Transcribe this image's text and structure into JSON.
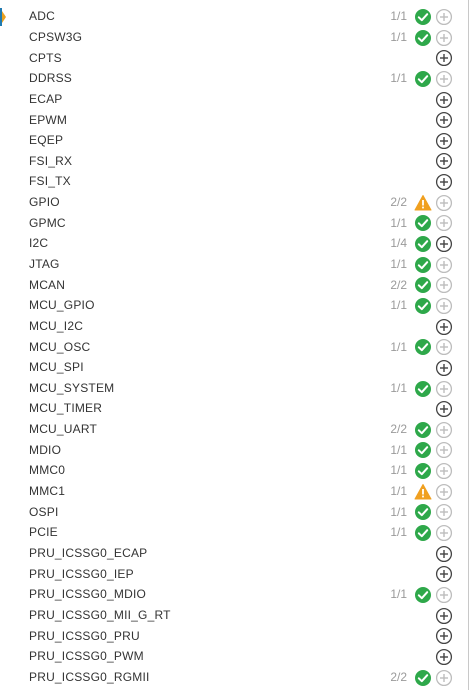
{
  "colors": {
    "ok": "#2ea84a",
    "warn": "#f0a020",
    "add_active": "#444444",
    "add_disabled": "#bdbdbd",
    "text": "#333333",
    "count": "#9a9a9a"
  },
  "modules": [
    {
      "name": "ADC",
      "count": "1/1",
      "status": "ok",
      "add": "disabled"
    },
    {
      "name": "CPSW3G",
      "count": "1/1",
      "status": "ok",
      "add": "disabled"
    },
    {
      "name": "CPTS",
      "count": "",
      "status": "none",
      "add": "active"
    },
    {
      "name": "DDRSS",
      "count": "1/1",
      "status": "ok",
      "add": "disabled"
    },
    {
      "name": "ECAP",
      "count": "",
      "status": "none",
      "add": "active"
    },
    {
      "name": "EPWM",
      "count": "",
      "status": "none",
      "add": "active"
    },
    {
      "name": "EQEP",
      "count": "",
      "status": "none",
      "add": "active"
    },
    {
      "name": "FSI_RX",
      "count": "",
      "status": "none",
      "add": "active"
    },
    {
      "name": "FSI_TX",
      "count": "",
      "status": "none",
      "add": "active"
    },
    {
      "name": "GPIO",
      "count": "2/2",
      "status": "warn",
      "add": "disabled"
    },
    {
      "name": "GPMC",
      "count": "1/1",
      "status": "ok",
      "add": "disabled"
    },
    {
      "name": "I2C",
      "count": "1/4",
      "status": "ok",
      "add": "active"
    },
    {
      "name": "JTAG",
      "count": "1/1",
      "status": "ok",
      "add": "disabled"
    },
    {
      "name": "MCAN",
      "count": "2/2",
      "status": "ok",
      "add": "disabled"
    },
    {
      "name": "MCU_GPIO",
      "count": "1/1",
      "status": "ok",
      "add": "disabled"
    },
    {
      "name": "MCU_I2C",
      "count": "",
      "status": "none",
      "add": "active"
    },
    {
      "name": "MCU_OSC",
      "count": "1/1",
      "status": "ok",
      "add": "disabled"
    },
    {
      "name": "MCU_SPI",
      "count": "",
      "status": "none",
      "add": "active"
    },
    {
      "name": "MCU_SYSTEM",
      "count": "1/1",
      "status": "ok",
      "add": "disabled"
    },
    {
      "name": "MCU_TIMER",
      "count": "",
      "status": "none",
      "add": "active"
    },
    {
      "name": "MCU_UART",
      "count": "2/2",
      "status": "ok",
      "add": "disabled"
    },
    {
      "name": "MDIO",
      "count": "1/1",
      "status": "ok",
      "add": "disabled"
    },
    {
      "name": "MMC0",
      "count": "1/1",
      "status": "ok",
      "add": "disabled"
    },
    {
      "name": "MMC1",
      "count": "1/1",
      "status": "warn",
      "add": "disabled"
    },
    {
      "name": "OSPI",
      "count": "1/1",
      "status": "ok",
      "add": "disabled"
    },
    {
      "name": "PCIE",
      "count": "1/1",
      "status": "ok",
      "add": "disabled"
    },
    {
      "name": "PRU_ICSSG0_ECAP",
      "count": "",
      "status": "none",
      "add": "active"
    },
    {
      "name": "PRU_ICSSG0_IEP",
      "count": "",
      "status": "none",
      "add": "active"
    },
    {
      "name": "PRU_ICSSG0_MDIO",
      "count": "1/1",
      "status": "ok",
      "add": "disabled"
    },
    {
      "name": "PRU_ICSSG0_MII_G_RT",
      "count": "",
      "status": "none",
      "add": "active"
    },
    {
      "name": "PRU_ICSSG0_PRU",
      "count": "",
      "status": "none",
      "add": "active"
    },
    {
      "name": "PRU_ICSSG0_PWM",
      "count": "",
      "status": "none",
      "add": "active"
    },
    {
      "name": "PRU_ICSSG0_RGMII",
      "count": "2/2",
      "status": "ok",
      "add": "disabled"
    }
  ]
}
